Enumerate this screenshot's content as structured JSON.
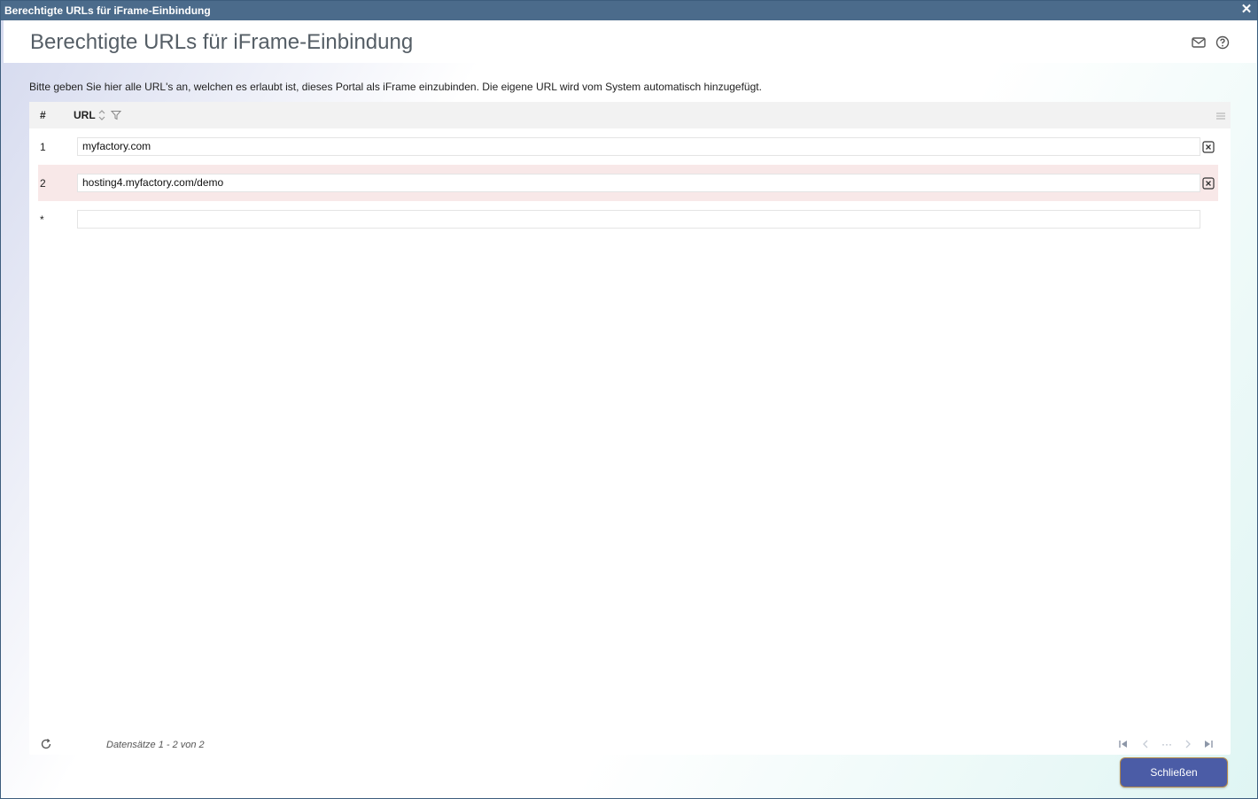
{
  "window": {
    "title": "Berechtigte URLs für iFrame-Einbindung",
    "close_glyph": "✕"
  },
  "header": {
    "title": "Berechtigte URLs für iFrame-Einbindung",
    "icons": [
      "mail-icon",
      "help-icon"
    ]
  },
  "hint": "Bitte geben Sie hier alle URL's an, welchen es erlaubt ist, dieses Portal als iFrame einzubinden. Die eigene URL wird vom System automatisch hinzugefügt.",
  "grid": {
    "columns": {
      "hash": "#",
      "url": "URL"
    },
    "rows": [
      {
        "num": "1",
        "url": "myfactory.com"
      },
      {
        "num": "2",
        "url": "hosting4.myfactory.com/demo"
      }
    ],
    "new_row_marker": "*",
    "footer": {
      "count": "Datensätze 1 - 2 von 2",
      "pager_ellipsis": "···"
    }
  },
  "buttons": {
    "close": "Schließen"
  },
  "colors": {
    "titlebar": "#4b6b8b",
    "button": "#4b5ca6",
    "selected_row": "#f8e8e8"
  }
}
